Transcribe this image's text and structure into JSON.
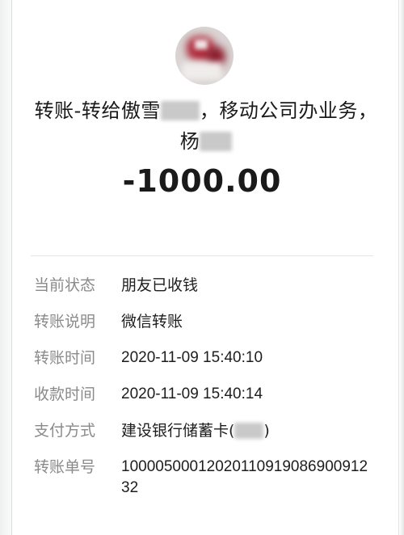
{
  "transaction": {
    "title_line1_part1": "转账-转给傲雪",
    "title_line1_part2": "，移动公司办业务，",
    "title_line2_part1": "杨",
    "amount": "-1000.00"
  },
  "details": [
    {
      "label": "当前状态",
      "value": "朋友已收钱"
    },
    {
      "label": "转账说明",
      "value": "微信转账"
    },
    {
      "label": "转账时间",
      "value": "2020-11-09 15:40:10"
    },
    {
      "label": "收款时间",
      "value": "2020-11-09 15:40:14"
    },
    {
      "label": "支付方式",
      "value_prefix": "建设银行储蓄卡(",
      "value_suffix": ")"
    },
    {
      "label": "转账单号",
      "value": "1000050001202011091908690091232"
    }
  ]
}
